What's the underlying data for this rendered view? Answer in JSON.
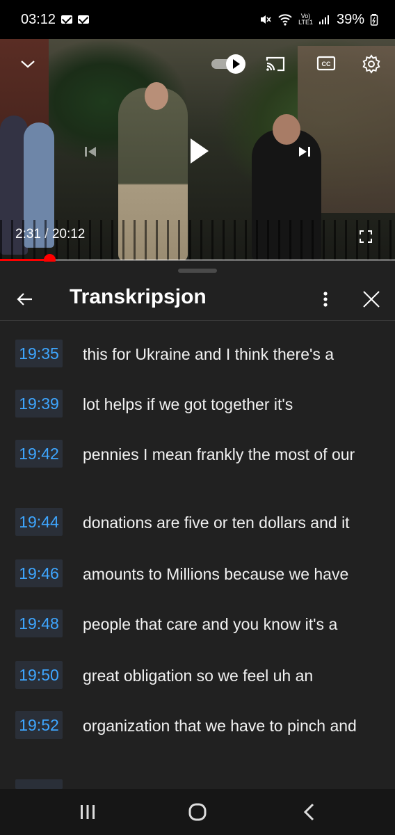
{
  "status_bar": {
    "time": "03:12",
    "network_label_top": "Vo)",
    "network_label_bottom": "LTE1",
    "battery": "39%"
  },
  "video": {
    "current_time": "2:31",
    "separator": "/",
    "duration": "20:12",
    "progress_fraction": 0.125,
    "autoplay_on": true
  },
  "panel": {
    "title": "Transkripsjon"
  },
  "transcript": [
    {
      "time": "19:35",
      "text": "this for Ukraine and I think there's a"
    },
    {
      "time": "19:39",
      "text": "lot helps if we got together it's"
    },
    {
      "time": "19:42",
      "text": "pennies I mean frankly the most of our"
    },
    {
      "time": "19:44",
      "text": "donations are five or ten dollars and it"
    },
    {
      "time": "19:46",
      "text": "amounts to Millions because we have"
    },
    {
      "time": "19:48",
      "text": "people that care and you know it's a"
    },
    {
      "time": "19:50",
      "text": "great obligation so we feel uh an"
    },
    {
      "time": "19:52",
      "text": "organization that we have to pinch and"
    }
  ],
  "colors": {
    "accent_timestamp": "#3ea6ff",
    "progress": "#ff0000",
    "panel_bg": "#212121"
  },
  "icons": [
    "mail-icon",
    "mute-icon",
    "wifi-icon",
    "signal-icon",
    "battery-icon",
    "chevron-down-icon",
    "autoplay-toggle-icon",
    "cast-icon",
    "cc-icon",
    "settings-icon",
    "previous-icon",
    "play-icon",
    "next-icon",
    "fullscreen-icon",
    "back-arrow-icon",
    "more-vert-icon",
    "close-icon",
    "recent-apps-icon",
    "home-icon",
    "back-icon"
  ]
}
